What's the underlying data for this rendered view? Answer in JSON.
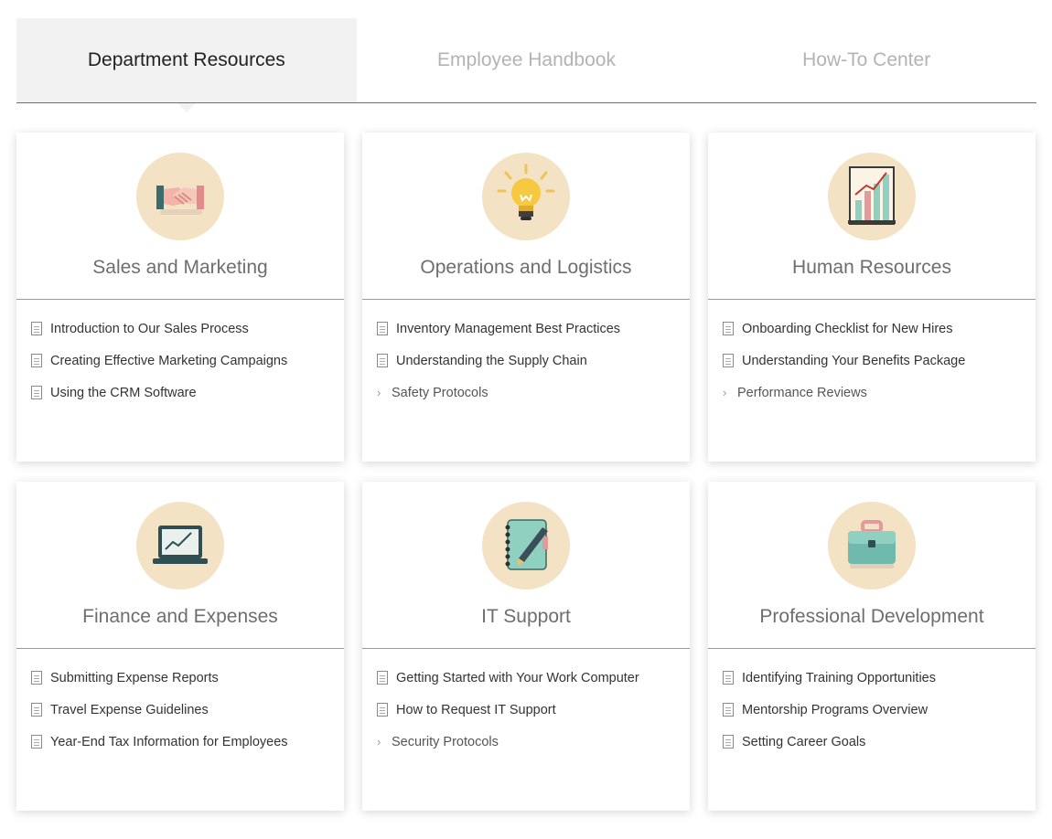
{
  "tabs": [
    {
      "label": "Department Resources",
      "active": true
    },
    {
      "label": "Employee Handbook",
      "active": false
    },
    {
      "label": "How-To Center",
      "active": false
    }
  ],
  "cards": [
    {
      "title": "Sales and Marketing",
      "icon": "handshake-icon",
      "items": [
        {
          "label": "Introduction to Our Sales Process",
          "type": "doc"
        },
        {
          "label": "Creating Effective Marketing Campaigns",
          "type": "doc"
        },
        {
          "label": "Using the CRM Software",
          "type": "doc"
        }
      ]
    },
    {
      "title": "Operations and Logistics",
      "icon": "lightbulb-icon",
      "items": [
        {
          "label": "Inventory Management Best Practices",
          "type": "doc"
        },
        {
          "label": "Understanding the Supply Chain",
          "type": "doc"
        },
        {
          "label": "Safety Protocols",
          "type": "folder"
        }
      ]
    },
    {
      "title": "Human Resources",
      "icon": "bar-chart-icon",
      "items": [
        {
          "label": "Onboarding Checklist for New Hires",
          "type": "doc"
        },
        {
          "label": "Understanding Your Benefits Package",
          "type": "doc"
        },
        {
          "label": "Performance Reviews",
          "type": "folder"
        }
      ]
    },
    {
      "title": "Finance and Expenses",
      "icon": "laptop-chart-icon",
      "items": [
        {
          "label": "Submitting Expense Reports",
          "type": "doc"
        },
        {
          "label": "Travel Expense Guidelines",
          "type": "doc"
        },
        {
          "label": "Year-End Tax Information for Employees",
          "type": "doc"
        }
      ]
    },
    {
      "title": "IT Support",
      "icon": "notebook-pen-icon",
      "items": [
        {
          "label": "Getting Started with Your Work Computer",
          "type": "doc"
        },
        {
          "label": "How to Request IT Support",
          "type": "doc"
        },
        {
          "label": "Security Protocols",
          "type": "folder"
        }
      ]
    },
    {
      "title": "Professional Development",
      "icon": "briefcase-icon",
      "items": [
        {
          "label": "Identifying Training Opportunities",
          "type": "doc"
        },
        {
          "label": "Mentorship Programs Overview",
          "type": "doc"
        },
        {
          "label": "Setting Career Goals",
          "type": "doc"
        }
      ]
    }
  ]
}
